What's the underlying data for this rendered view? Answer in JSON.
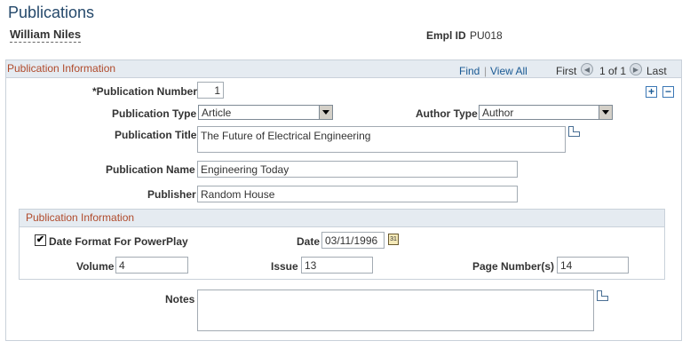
{
  "page": {
    "title": "Publications"
  },
  "employee": {
    "name": "William Niles",
    "id_label": "Empl ID",
    "id_value": "PU018"
  },
  "grid": {
    "title": "Publication Information",
    "find": "Find",
    "sep": "|",
    "view_all": "View All",
    "first": "First",
    "position": "1 of 1",
    "last": "Last"
  },
  "form": {
    "publication_number": {
      "label": "*Publication Number",
      "value": "1"
    },
    "publication_type": {
      "label": "Publication Type",
      "value": "Article"
    },
    "author_type": {
      "label": "Author Type",
      "value": "Author"
    },
    "publication_title": {
      "label": "Publication Title",
      "value": "The Future of Electrical Engineering"
    },
    "publication_name": {
      "label": "Publication Name",
      "value": "Engineering Today"
    },
    "publisher": {
      "label": "Publisher",
      "value": "Random House"
    }
  },
  "sub_group": {
    "title": "Publication Information",
    "date_format": {
      "label": "Date Format For PowerPlay",
      "checked": true,
      "mark": "✔"
    },
    "date": {
      "label": "Date",
      "value": "03/11/1996"
    },
    "volume": {
      "label": "Volume",
      "value": "4"
    },
    "issue": {
      "label": "Issue",
      "value": "13"
    },
    "page_numbers": {
      "label": "Page Number(s)",
      "value": "14"
    }
  },
  "notes": {
    "label": "Notes",
    "value": ""
  },
  "controls": {
    "add": "+",
    "remove": "−",
    "prev_glyph": "◀",
    "next_glyph": "▶",
    "cal_glyph": "31"
  },
  "colors": {
    "title": "#25496b",
    "group_title": "#b04a2b",
    "link": "#1a5a94",
    "header_bg": "#e5ebf1"
  }
}
